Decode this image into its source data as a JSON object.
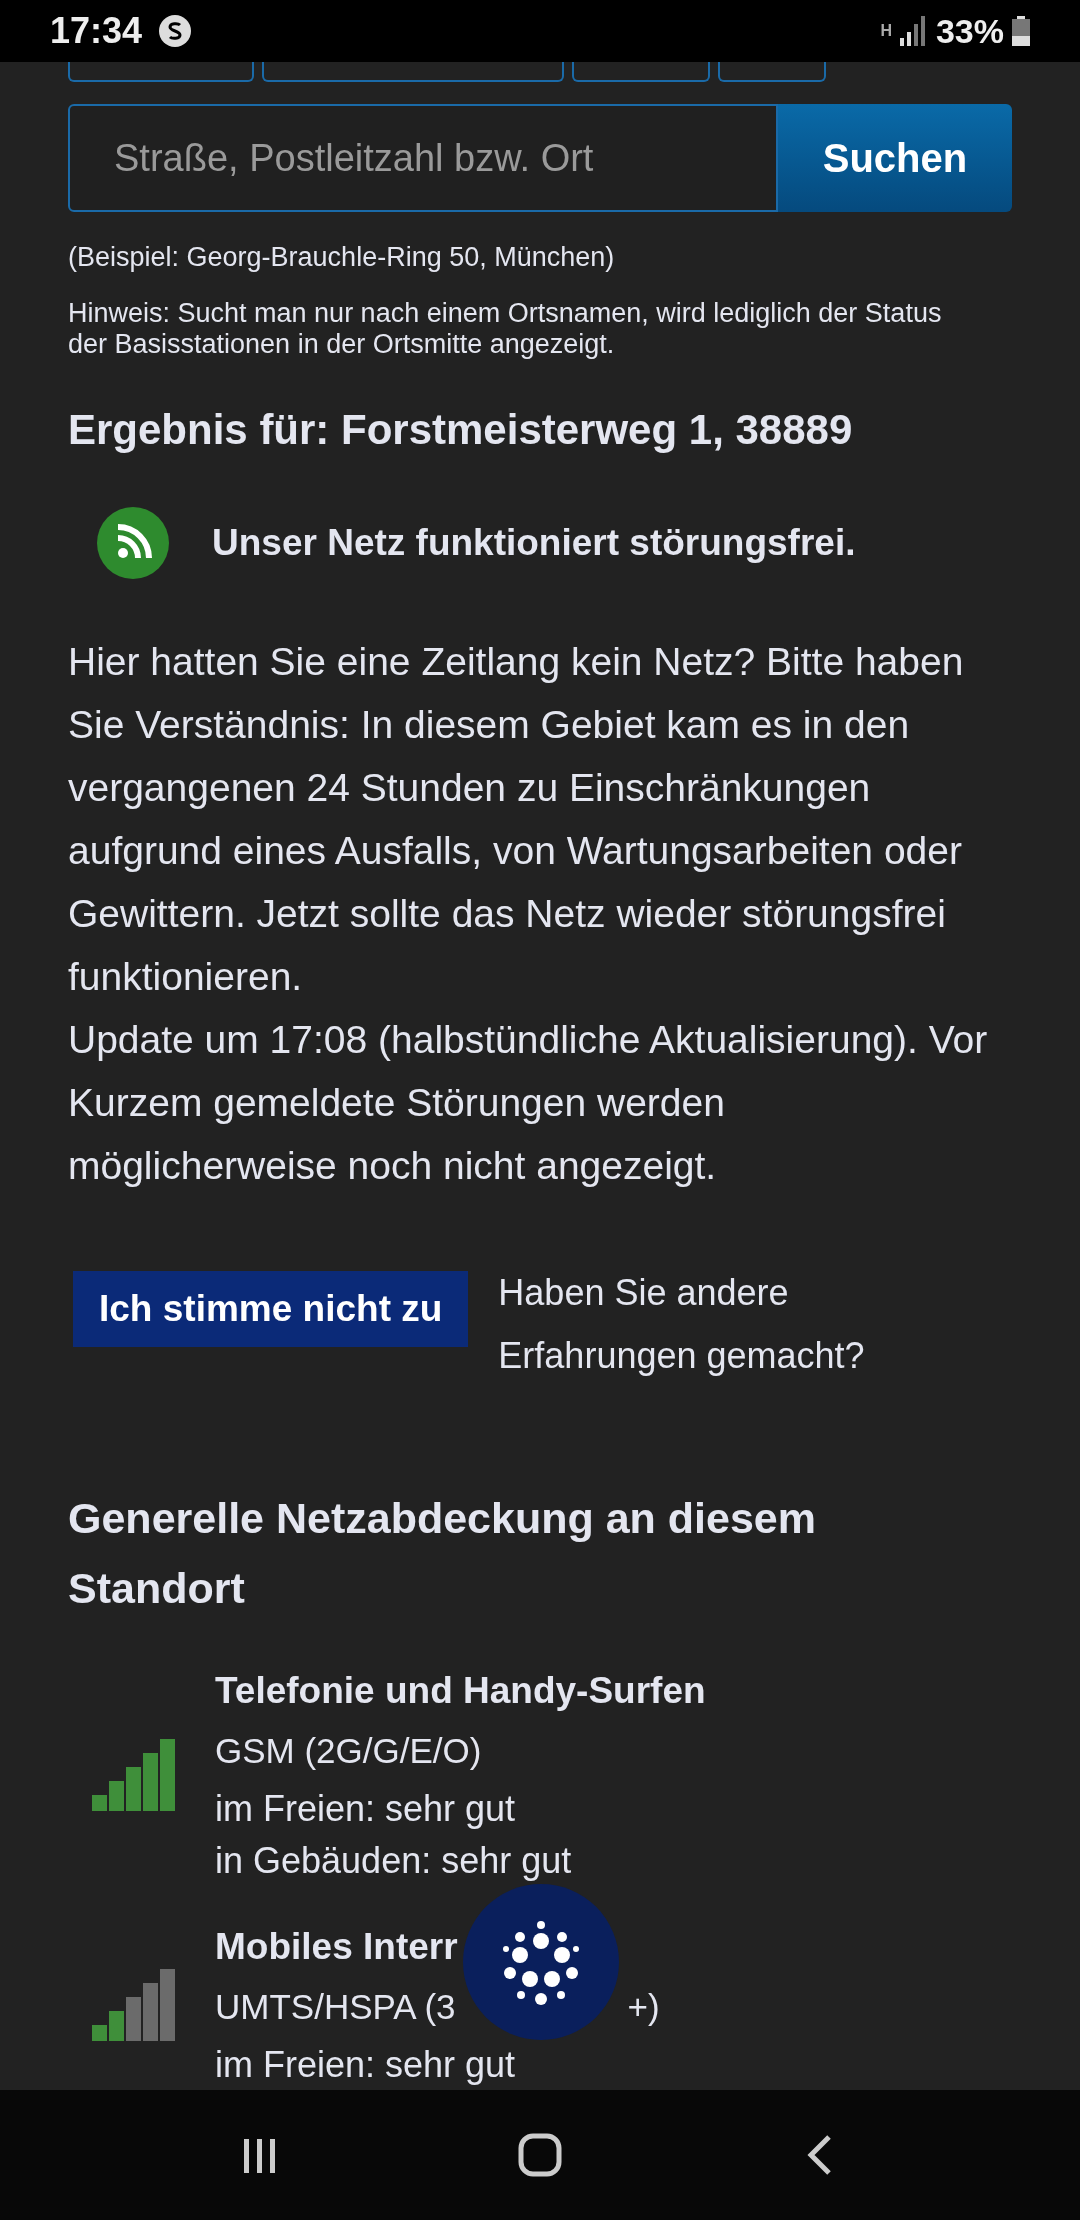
{
  "status_bar": {
    "time": "17:34",
    "network": "H",
    "battery": "33%"
  },
  "search": {
    "placeholder": "Straße, Postleitzahl bzw. Ort",
    "button": "Suchen"
  },
  "example": "(Beispiel: Georg-Brauchle-Ring 50, München)",
  "hint": "Hinweis: Sucht man nur nach einem Ortsnamen, wird lediglich der Status der Basisstationen in der Ortsmitte angezeigt.",
  "result_title": "Ergebnis für: Forstmeisterweg 1, 38889",
  "status": {
    "ok": true,
    "text": "Unser Netz funktioniert störungsfrei."
  },
  "paragraphs": [
    "Hier hatten Sie eine Zeitlang kein Netz? Bitte haben Sie Verständnis: In diesem Gebiet kam es in den vergangenen 24 Stunden zu Einschränkungen aufgrund eines Ausfalls, von Wartungsarbeiten oder Gewittern. Jetzt sollte das Netz wieder störungsfrei funktionieren.",
    "Update um 17:08 (halbstündliche Aktualisierung). Vor Kurzem gemeldete Störungen werden möglicherweise noch nicht angezeigt."
  ],
  "disagree": {
    "button": "Ich stimme nicht zu",
    "text": "Haben Sie andere Erfahrungen gemacht?"
  },
  "coverage_title": "Generelle Netzabdeckung an diesem Standort",
  "coverage": [
    {
      "title": "Telefonie und Handy-Surfen",
      "level": 1,
      "tech": "GSM (2G/G/E/O)",
      "lines": [
        "im Freien: sehr gut",
        "in Gebäuden: sehr gut"
      ]
    },
    {
      "title": "Mobiles Interr",
      "level": 0.4,
      "tech": "UMTS/HSPA (3",
      "tech_tail": "+)",
      "lines": [
        "im Freien: sehr gut"
      ]
    }
  ]
}
